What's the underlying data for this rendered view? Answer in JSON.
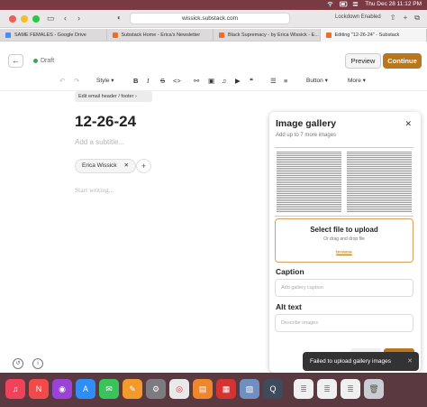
{
  "menubar": {
    "datetime": "Thu Dec 28  11:12 PM"
  },
  "browser": {
    "url": "wissick.substack.com",
    "lockdown": "Lockdown Enabled",
    "tabs": [
      {
        "label": "SAME FEMALES - Google Drive",
        "color": "#4c8bf5"
      },
      {
        "label": "Substack Home - Erica's Newsletter",
        "color": "#e8702a"
      },
      {
        "label": "Black Supremacy - by Erica Wissick - E...",
        "color": "#e8702a"
      },
      {
        "label": "Editing \"12-26-24\" - Substack",
        "color": "#e8702a"
      }
    ]
  },
  "editor": {
    "status": "Draft",
    "preview_label": "Preview",
    "continue_label": "Continue",
    "toolbar": {
      "style_label": "Style",
      "button_label": "Button",
      "more_label": "More"
    },
    "email_header_label": "Edit email header / footer",
    "title": "12-26-24",
    "subtitle_placeholder": "Add a subtitle...",
    "author": "Erica Wissick",
    "body_placeholder": "Start writing..."
  },
  "gallery": {
    "title": "Image gallery",
    "subtitle": "Add up to 7 more images",
    "upload_title": "Select file to upload",
    "upload_sub": "Or drag and drop file",
    "browse_label": "browse",
    "caption_label": "Caption",
    "caption_placeholder": "Add gallery caption",
    "alt_label": "Alt text",
    "alt_placeholder": "Describe images"
  },
  "toast": {
    "message": "Failed to upload gallery images"
  },
  "colors": {
    "accent": "#b8771f",
    "menubar": "#7a3a44"
  },
  "dock": {
    "apps": [
      {
        "icon": "music-icon",
        "color": "#f1425b"
      },
      {
        "icon": "news-icon",
        "color": "#f14a4a"
      },
      {
        "icon": "podcasts-icon",
        "color": "#9a43d6"
      },
      {
        "icon": "app-store-icon",
        "color": "#2e8ef5"
      },
      {
        "icon": "messages-icon",
        "color": "#38c45a"
      },
      {
        "icon": "pages-icon",
        "color": "#f29a2a"
      },
      {
        "icon": "settings-icon",
        "color": "#7b7b80"
      },
      {
        "icon": "chrome-icon",
        "color": "#e9e9e9"
      },
      {
        "icon": "books-icon",
        "color": "#f0862c"
      },
      {
        "icon": "photo-booth-icon",
        "color": "#d63232"
      },
      {
        "icon": "preview-icon",
        "color": "#6e8fbf"
      },
      {
        "icon": "quicktime-icon",
        "color": "#3d4b5c"
      },
      {
        "icon": "document-thumb-icon",
        "color": "#f0f0f0"
      },
      {
        "icon": "document-thumb-icon",
        "color": "#f0f0f0"
      },
      {
        "icon": "document-thumb-icon",
        "color": "#f0f0f0"
      },
      {
        "icon": "trash-icon",
        "color": "#c9ccd0"
      }
    ]
  }
}
